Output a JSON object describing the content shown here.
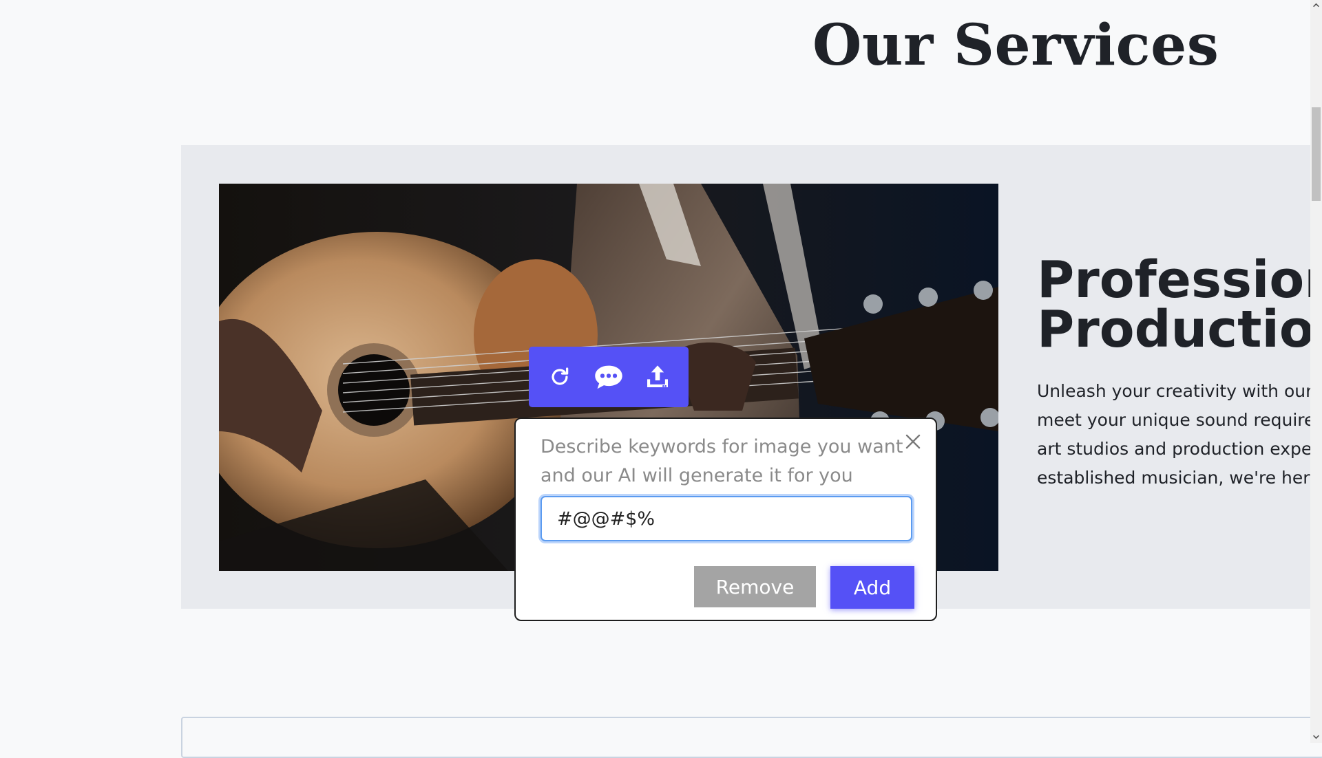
{
  "page": {
    "title": "Our Services"
  },
  "service": {
    "heading_line1": "Professiona",
    "heading_line2": "Production",
    "text_lines": [
      "Unleash your creativity with our",
      "meet your unique sound requiren",
      "art studios and production exper",
      "established musician, we're here"
    ],
    "image_icon": "acoustic-guitar-photo"
  },
  "toolbar": {
    "items": [
      {
        "icon": "refresh-icon"
      },
      {
        "icon": "chat-bubble-icon"
      },
      {
        "icon": "upload-icon"
      }
    ],
    "color": "#5551f6"
  },
  "ai_popup": {
    "description_line1": "Describe keywords for image you want",
    "description_line2": "and our AI will generate it for you",
    "input_value": "#@@#$%",
    "remove_label": "Remove",
    "add_label": "Add",
    "close_icon": "close-icon"
  },
  "colors": {
    "accent": "#5551f6",
    "remove_button": "#a4a4a4",
    "card_background": "#e8eaee",
    "page_background": "#f8f9fa"
  }
}
